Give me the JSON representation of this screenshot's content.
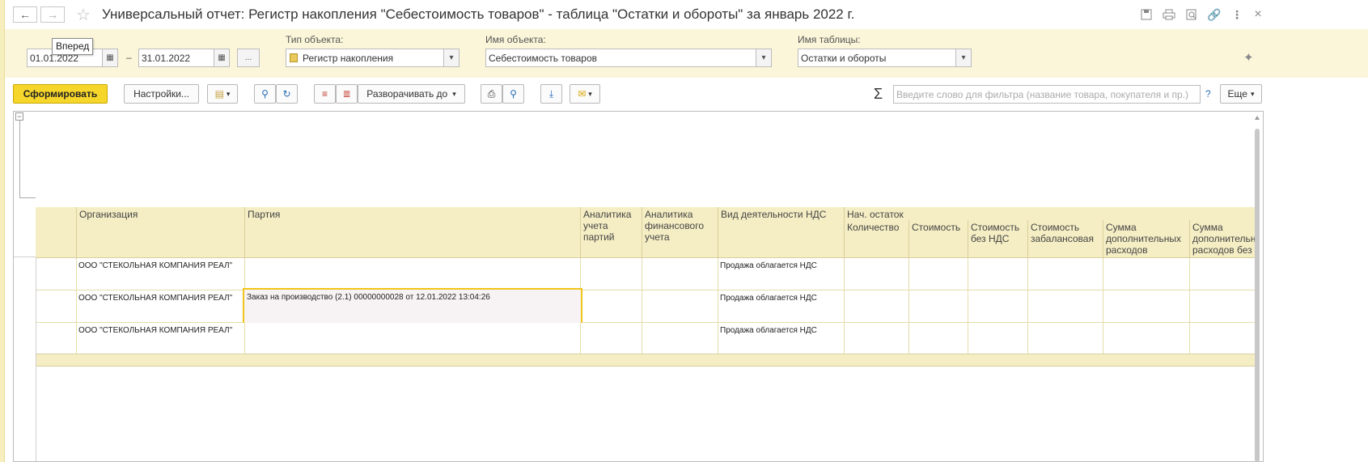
{
  "window": {
    "title": "Универсальный отчет: Регистр накопления \"Себестоимость товаров\" - таблица \"Остатки и обороты\" за январь 2022 г.",
    "tooltip": "Вперед",
    "icons": [
      "back-arrow-icon",
      "forward-arrow-icon",
      "star-icon",
      "save-icon",
      "print-icon",
      "preview-icon",
      "link-icon",
      "more-vert-icon",
      "close-icon"
    ]
  },
  "filters": {
    "date_from": "01.01.2022",
    "date_dash": "–",
    "date_to": "31.01.2022",
    "ellipsis": "...",
    "object_type_label": "Тип объекта:",
    "object_type_value": "Регистр накопления",
    "object_name_label": "Имя объекта:",
    "object_name_value": "Себестоимость товаров",
    "table_name_label": "Имя таблицы:",
    "table_name_value": "Остатки и обороты"
  },
  "toolbar": {
    "generate": "Сформировать",
    "settings": "Настройки...",
    "expand_to": "Разворачивать до",
    "search_placeholder": "Введите слово для фильтра (название товара, покупателя и пр.)",
    "help": "?",
    "more": "Еще",
    "sigma": "Σ"
  },
  "table": {
    "headers": {
      "org": "Организация",
      "party": "Партия",
      "party_analytics": "Аналитика учета партий",
      "fin_analytics": "Аналитика финансового учета",
      "vat_activity": "Вид деятельности НДС",
      "opening_balance": "Нач. остаток",
      "qty": "Количество",
      "cost": "Стоимость",
      "cost_no_vat": "Стоимость без НДС",
      "cost_offbalance": "Стоимость забалансовая",
      "add_costs": "Сумма дополнительных расходов",
      "add_costs_no_vat": "Сумма дополнительных расходов без"
    },
    "rows": [
      {
        "org": "ООО \"СТЕКОЛЬНАЯ КОМПАНИЯ РЕАЛ\"",
        "party": "",
        "vat_activity": "Продажа облагается НДС"
      },
      {
        "org": "ООО \"СТЕКОЛЬНАЯ КОМПАНИЯ РЕАЛ\"",
        "party": "Заказ на производство (2.1) 00000000028 от 12.01.2022 13:04:26",
        "vat_activity": "Продажа облагается НДС"
      },
      {
        "org": "ООО \"СТЕКОЛЬНАЯ КОМПАНИЯ РЕАЛ\"",
        "party": "",
        "vat_activity": "Продажа облагается НДС"
      }
    ]
  },
  "colors": {
    "accent": "#f7d62b",
    "panel": "#fbf6d9",
    "header": "#f5eec4",
    "selection": "#f0c419"
  }
}
